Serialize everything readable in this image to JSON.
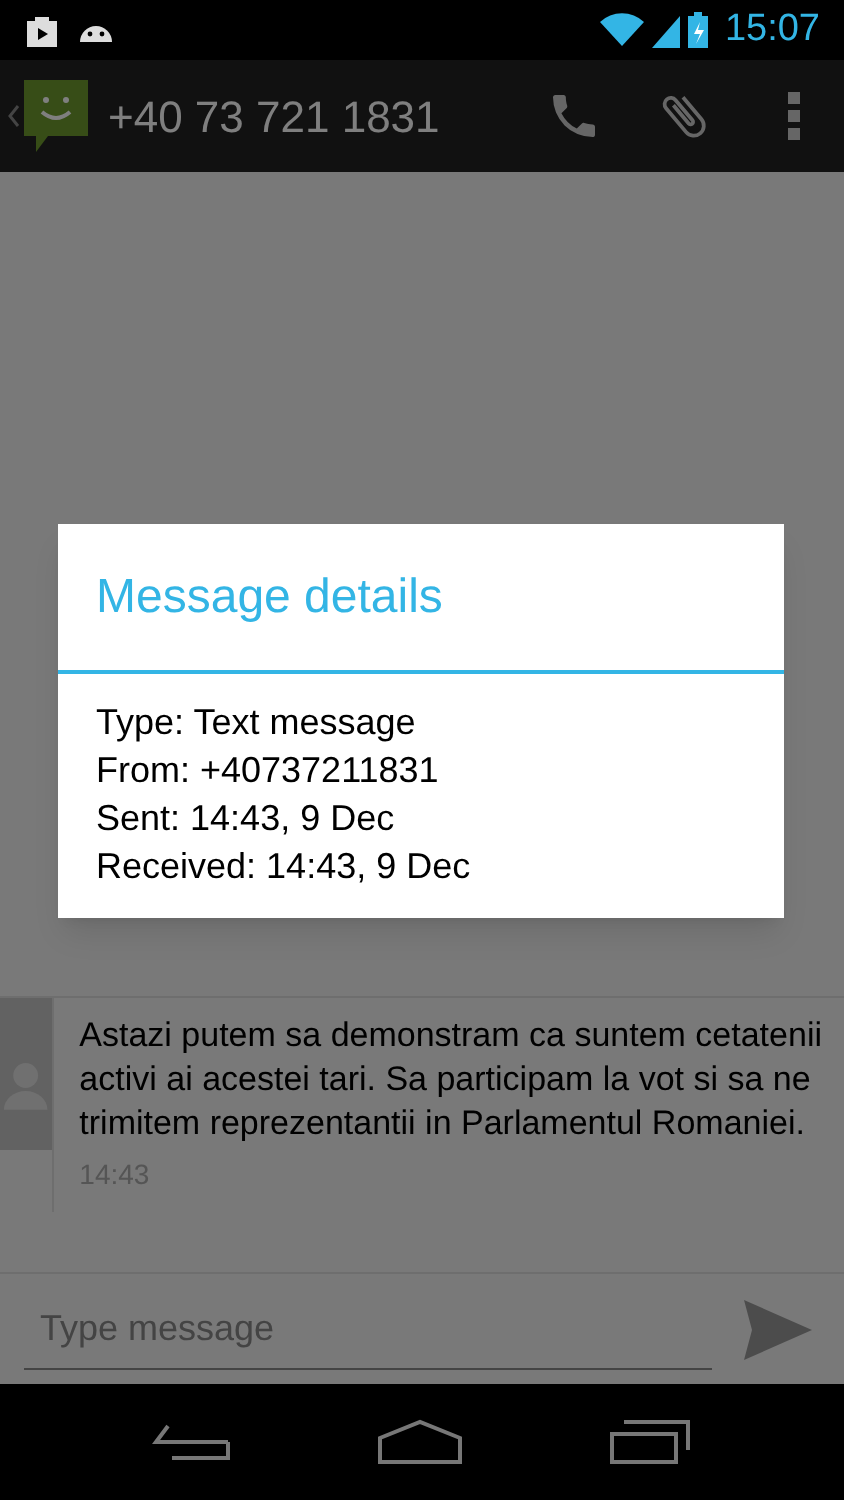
{
  "status_bar": {
    "time": "15:07"
  },
  "action_bar": {
    "title": "+40 73 721 1831"
  },
  "dialog": {
    "title": "Message details",
    "lines": [
      "Type: Text message",
      "From: +40737211831",
      "Sent: 14:43, 9 Dec",
      "Received: 14:43, 9 Dec"
    ]
  },
  "messages": [
    {
      "text": "Astazi putem sa demonstram ca suntem cetatenii activi ai acestei tari. Sa participam la vot si sa ne trimitem reprezentantii in Parlamentul Romaniei.",
      "time": "14:43"
    }
  ],
  "compose": {
    "placeholder": "Type message"
  }
}
